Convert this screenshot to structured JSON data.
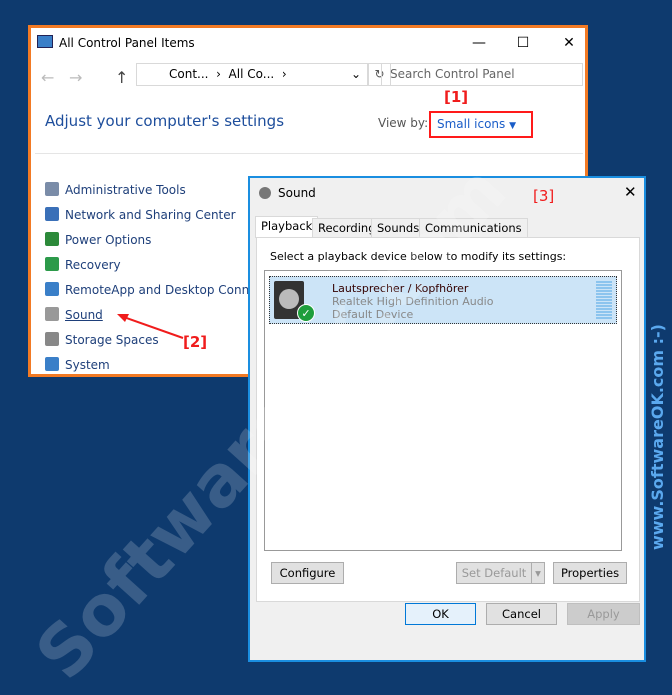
{
  "control_panel": {
    "title": "All Control Panel Items",
    "breadcrumb": [
      "Cont...",
      "All Co..."
    ],
    "search_placeholder": "Search Control Panel",
    "heading": "Adjust your computer's settings",
    "view_by_label": "View by:",
    "view_by_value": "Small icons",
    "items": [
      {
        "label": "Administrative Tools",
        "icon": "admin-tools-icon"
      },
      {
        "label": "Network and Sharing Center",
        "icon": "network-icon"
      },
      {
        "label": "Power Options",
        "icon": "power-icon"
      },
      {
        "label": "Recovery",
        "icon": "recovery-icon"
      },
      {
        "label": "RemoteApp and Desktop Connecti",
        "icon": "remoteapp-icon"
      },
      {
        "label": "Sound",
        "icon": "speaker-icon"
      },
      {
        "label": "Storage Spaces",
        "icon": "storage-icon"
      },
      {
        "label": "System",
        "icon": "system-icon"
      }
    ]
  },
  "annotations": [
    "[1]",
    "[2]",
    "[3]"
  ],
  "sound": {
    "title": "Sound",
    "tabs": [
      "Playback",
      "Recording",
      "Sounds",
      "Communications"
    ],
    "active_tab": "Playback",
    "instruction": "Select a playback device below to modify its settings:",
    "device": {
      "name": "Lautsprecher / Kopfhörer",
      "driver": "Realtek High Definition Audio",
      "status": "Default Device"
    },
    "buttons": {
      "configure": "Configure",
      "set_default": "Set Default",
      "properties": "Properties",
      "ok": "OK",
      "cancel": "Cancel",
      "apply": "Apply"
    }
  },
  "watermark": {
    "diagonal": "SoftwareOK.com",
    "vertical": "www.SoftwareOK.com :-)"
  },
  "colors": {
    "background": "#0e3a6e",
    "highlight_orange": "#f27a24",
    "dialog_border": "#1a8ee0",
    "annotation": "#f01c1c"
  }
}
